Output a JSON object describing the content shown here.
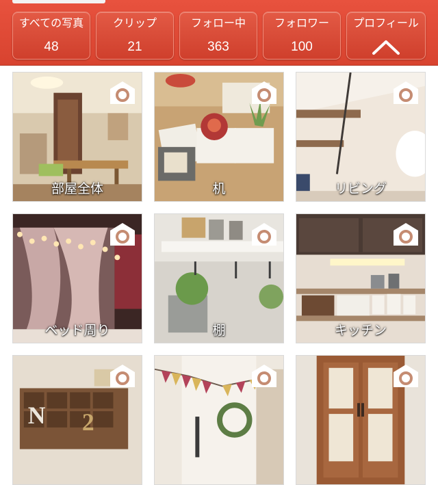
{
  "header": {
    "stats": [
      {
        "label": "すべての写真",
        "value": "48"
      },
      {
        "label": "クリップ",
        "value": "21"
      },
      {
        "label": "フォロー中",
        "value": "363"
      },
      {
        "label": "フォロワー",
        "value": "100"
      }
    ],
    "profile": {
      "label": "プロフィール",
      "icon": "chevron-up-icon"
    }
  },
  "albums": [
    {
      "label": "部屋全体",
      "icon": "camera-icon"
    },
    {
      "label": "机",
      "icon": "camera-icon"
    },
    {
      "label": "リビング",
      "icon": "camera-icon"
    },
    {
      "label": "ベッド周り",
      "icon": "camera-icon"
    },
    {
      "label": "棚",
      "icon": "camera-icon"
    },
    {
      "label": "キッチン",
      "icon": "camera-icon"
    },
    {
      "label": "",
      "icon": "camera-icon"
    },
    {
      "label": "",
      "icon": "camera-icon"
    },
    {
      "label": "",
      "icon": "camera-icon"
    }
  ],
  "colors": {
    "header": "#d8432f",
    "accent": "#e35a45",
    "text_on_accent": "#ffffff"
  }
}
